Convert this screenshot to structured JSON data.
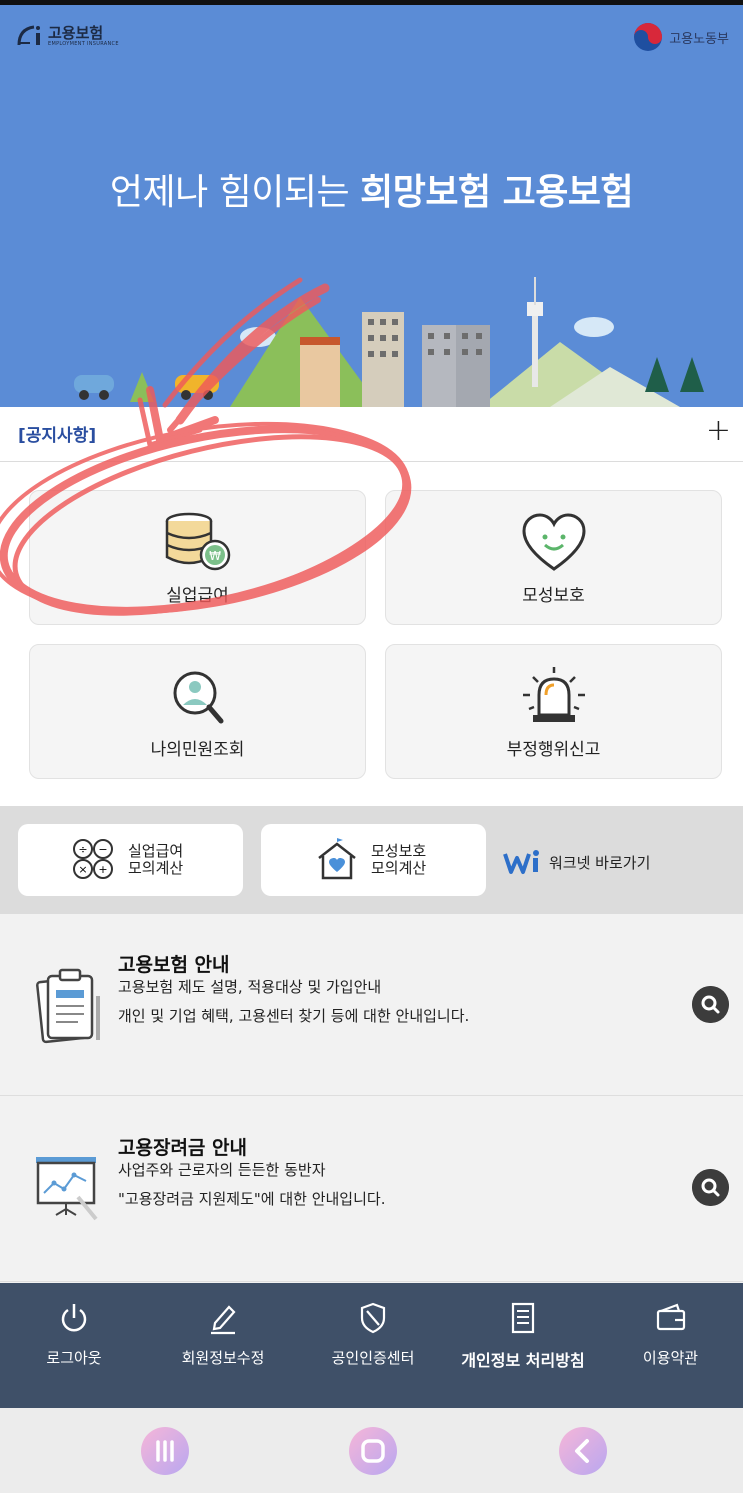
{
  "header": {
    "logo_title": "고용보험",
    "logo_sub": "EMPLOYMENT INSURANCE",
    "ministry": "고용노동부"
  },
  "hero": {
    "slogan_light": "언제나 힘이되는 ",
    "slogan_bold": "희망보험 고용보험"
  },
  "notice": {
    "label": "[공지사항]",
    "plus": "+"
  },
  "menu": {
    "tiles": [
      {
        "label": "실업급여",
        "icon": "coins-won-icon"
      },
      {
        "label": "모성보호",
        "icon": "heart-smile-icon"
      },
      {
        "label": "나의민원조회",
        "icon": "search-person-icon"
      },
      {
        "label": "부정행위신고",
        "icon": "siren-icon"
      }
    ]
  },
  "calc": {
    "unemployment_line1": "실업급여",
    "unemployment_line2": "모의계산",
    "maternity_line1": "모성보호",
    "maternity_line2": "모의계산",
    "worknet": "워크넷 바로가기"
  },
  "info": [
    {
      "title": "고용보험 안내",
      "desc1": "고용보험 제도 설명, 적용대상 및 가입안내",
      "desc2": "개인 및 기업 혜택, 고용센터 찾기 등에 대한 안내입니다."
    },
    {
      "title": "고용장려금 안내",
      "desc1": "사업주와 근로자의 든든한 동반자",
      "desc2": "\"고용장려금 지원제도\"에 대한 안내입니다."
    }
  ],
  "bottom_nav": [
    {
      "label": "로그아웃",
      "icon": "power-icon"
    },
    {
      "label": "회원정보수정",
      "icon": "edit-icon"
    },
    {
      "label": "공인인증센터",
      "icon": "shield-icon"
    },
    {
      "label": "개인정보 처리방침",
      "icon": "document-icon"
    },
    {
      "label": "이용약관",
      "icon": "wallet-icon"
    }
  ],
  "colors": {
    "hero_bg": "#5b8cd6",
    "nav_bg": "#3f5068",
    "annotation": "#ef5a5a"
  }
}
